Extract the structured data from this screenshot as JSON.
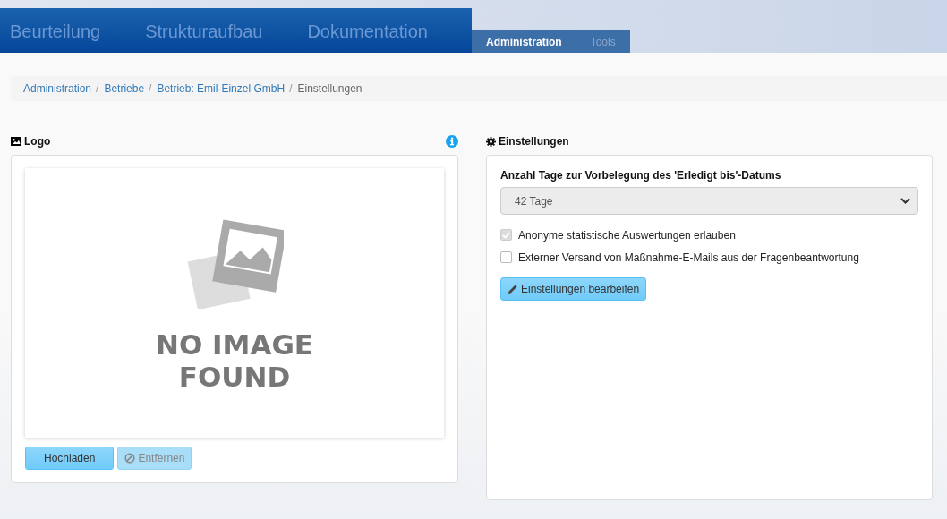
{
  "nav": {
    "main_tabs": [
      {
        "label": "Beurteilung"
      },
      {
        "label": "Strukturaufbau"
      },
      {
        "label": "Dokumentation"
      }
    ],
    "sub_tabs": [
      {
        "label": "Administration",
        "selected": true
      },
      {
        "label": "Tools",
        "selected": false
      }
    ]
  },
  "breadcrumb": [
    {
      "label": "Administration",
      "current": false,
      "separator": "/"
    },
    {
      "label": "Betriebe",
      "current": false,
      "separator": "/"
    },
    {
      "label": "Betrieb: Emil-Einzel GmbH",
      "current": false,
      "separator": "/"
    },
    {
      "label": "Einstellungen",
      "current": true
    }
  ],
  "logo_panel": {
    "title": "Logo",
    "placeholder_text": [
      "NO IMAGE",
      "FOUND"
    ],
    "buttons": [
      {
        "label": "Hochladen",
        "disabled": false,
        "kind": "plain"
      },
      {
        "label": "Entfernen",
        "disabled": true,
        "kind": "ban"
      }
    ]
  },
  "settings_panel": {
    "title": "Einstellungen",
    "select": {
      "label": "Anzahl Tage zur Vorbelegung des 'Erledigt bis'-Datums",
      "value": "42 Tage",
      "disabled": true
    },
    "checkboxes": [
      {
        "label": "Anonyme statistische Auswertungen erlauben",
        "checked": true,
        "disabled": true
      },
      {
        "label": "Externer Versand von Maßnahme-E-Mails aus der Fragenbeantwortung",
        "checked": false,
        "disabled": false
      }
    ],
    "button": {
      "label": "Einstellungen bearbeiten"
    }
  }
}
